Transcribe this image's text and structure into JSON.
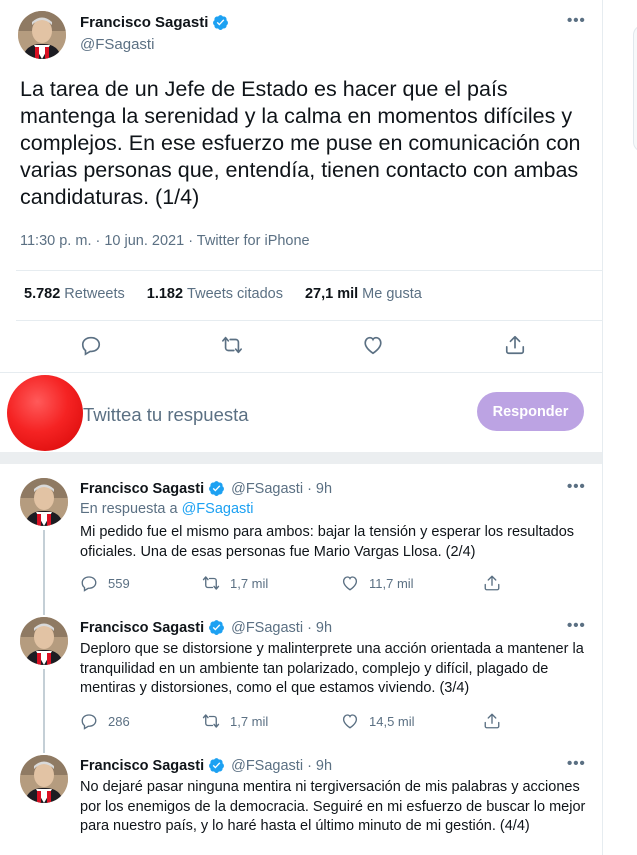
{
  "main_tweet": {
    "author_name": "Francisco Sagasti",
    "author_handle": "@FSagasti",
    "more_label": "•••",
    "text": "La tarea de un Jefe de Estado es hacer que el país mantenga la serenidad y la calma en momentos difíciles y complejos. En ese esfuerzo me puse en comunicación con varias personas que, entendía, tienen contacto con ambas candidaturas. (1/4)",
    "meta": "11:30 p. m. · 10 jun. 2021 · Twitter for iPhone",
    "stats": {
      "retweets_count": "5.782",
      "retweets_label": "Retweets",
      "quotes_count": "1.182",
      "quotes_label": "Tweets citados",
      "likes_count": "27,1 mil",
      "likes_label": "Me gusta"
    },
    "actions": [
      "reply-icon",
      "retweet-icon",
      "like-icon",
      "share-icon"
    ]
  },
  "reply_composer": {
    "placeholder": "Twittea tu respuesta",
    "button_label": "Responder",
    "button_color": "#bca3e3"
  },
  "thread": [
    {
      "name": "Francisco Sagasti",
      "handle_time": "@FSagasti · 9h",
      "in_reply_prefix": "En respuesta a",
      "in_reply_handle": "@FSagasti",
      "text": "Mi pedido fue el mismo para ambos: bajar la tensión y esperar los resultados oficiales. Una de esas personas fue Mario Vargas Llosa. (2/4)",
      "replies": "559",
      "retweets": "1,7 mil",
      "likes": "11,7 mil"
    },
    {
      "name": "Francisco Sagasti",
      "handle_time": "@FSagasti · 9h",
      "text": "Deploro que se distorsione y malinterprete una acción orientada a mantener la tranquilidad en un ambiente tan polarizado, complejo y difícil, plagado de mentiras y distorsiones, como el que estamos viviendo. (3/4)",
      "replies": "286",
      "retweets": "1,7 mil",
      "likes": "14,5 mil"
    },
    {
      "name": "Francisco Sagasti",
      "handle_time": "@FSagasti · 9h",
      "text": "No dejaré pasar ninguna mentira ni tergiversación de mis palabras y acciones por los enemigos de la democracia. Seguiré en mi esfuerzo de buscar lo mejor para nuestro país, y lo haré hasta el último minuto de mi gestión. (4/4)"
    }
  ],
  "colors": {
    "accent": "#1da1f2",
    "verified": "#1da1f2",
    "muted": "#5b7083"
  }
}
